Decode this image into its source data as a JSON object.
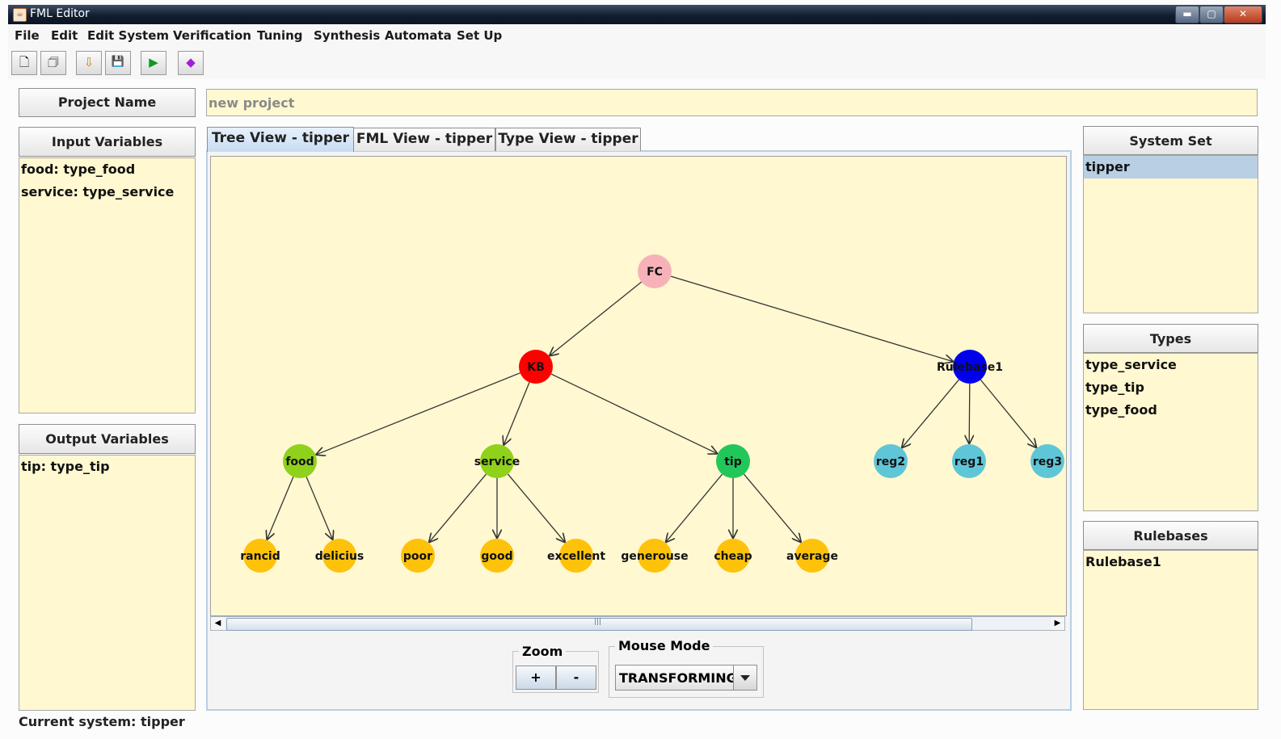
{
  "window": {
    "title": "FML Editor",
    "minimize": "▬",
    "maximize": "▢",
    "close": "✕"
  },
  "menu": [
    "File",
    "Edit",
    "Edit System",
    "Verification",
    "Tuning",
    "Synthesis",
    "Automata",
    "Set Up"
  ],
  "toolbar": {
    "icons": [
      "new-file-icon",
      "open-project-icon",
      "import-icon",
      "save-icon",
      "run-icon",
      "surface-plot-icon"
    ],
    "glyphs": [
      "🗋",
      "🗇",
      "⇩",
      "💾",
      "▶",
      "◆"
    ]
  },
  "project": {
    "label": "Project Name",
    "value": "new project"
  },
  "input_variables": {
    "label": "Input Variables",
    "items": [
      "food: type_food",
      "service: type_service"
    ]
  },
  "output_variables": {
    "label": "Output Variables",
    "items": [
      "tip: type_tip"
    ]
  },
  "status": "Current system: tipper",
  "tabs": [
    "Tree View - tipper",
    "FML View - tipper",
    "Type View - tipper"
  ],
  "active_tab": 0,
  "system_set": {
    "label": "System Set",
    "items": [
      "tipper"
    ],
    "selected": 0
  },
  "types": {
    "label": "Types",
    "items": [
      "type_service",
      "type_tip",
      "type_food"
    ]
  },
  "rulebases": {
    "label": "Rulebases",
    "items": [
      "Rulebase1"
    ]
  },
  "zoom": {
    "label": "Zoom",
    "in": "+",
    "out": "-"
  },
  "mouse_mode": {
    "label": "Mouse Mode",
    "value": "TRANSFORMING"
  },
  "scrollbar": {
    "left_arrow": "◀",
    "right_arrow": "▶",
    "grip": "|||"
  },
  "colors": {
    "root": "#f7b2b9",
    "kb": "#ff0000",
    "rulebase": "#0000ee",
    "variable_light": "#8fd11b",
    "variable_green": "#22c75a",
    "rule": "#5fc6d8",
    "term": "#ffc20a",
    "panel_bg": "#fff8d0"
  },
  "tree": {
    "nodes": [
      {
        "id": "FC",
        "label": "FC",
        "color_key": "root"
      },
      {
        "id": "KB",
        "label": "KB",
        "color_key": "kb"
      },
      {
        "id": "Rulebase1",
        "label": "Rulebase1",
        "color_key": "rulebase"
      },
      {
        "id": "food",
        "label": "food",
        "color_key": "variable_light"
      },
      {
        "id": "service",
        "label": "service",
        "color_key": "variable_light"
      },
      {
        "id": "tip",
        "label": "tip",
        "color_key": "variable_green"
      },
      {
        "id": "reg2",
        "label": "reg2",
        "color_key": "rule"
      },
      {
        "id": "reg1",
        "label": "reg1",
        "color_key": "rule"
      },
      {
        "id": "reg3",
        "label": "reg3",
        "color_key": "rule"
      },
      {
        "id": "rancid",
        "label": "rancid",
        "color_key": "term"
      },
      {
        "id": "delicius",
        "label": "delicius",
        "color_key": "term"
      },
      {
        "id": "poor",
        "label": "poor",
        "color_key": "term"
      },
      {
        "id": "good",
        "label": "good",
        "color_key": "term"
      },
      {
        "id": "excellent",
        "label": "excellent",
        "color_key": "term"
      },
      {
        "id": "generouse",
        "label": "generouse",
        "color_key": "term"
      },
      {
        "id": "cheap",
        "label": "cheap",
        "color_key": "term"
      },
      {
        "id": "average",
        "label": "average",
        "color_key": "term"
      }
    ],
    "edges": [
      [
        "FC",
        "KB"
      ],
      [
        "FC",
        "Rulebase1"
      ],
      [
        "KB",
        "food"
      ],
      [
        "KB",
        "service"
      ],
      [
        "KB",
        "tip"
      ],
      [
        "Rulebase1",
        "reg2"
      ],
      [
        "Rulebase1",
        "reg1"
      ],
      [
        "Rulebase1",
        "reg3"
      ],
      [
        "food",
        "rancid"
      ],
      [
        "food",
        "delicius"
      ],
      [
        "service",
        "poor"
      ],
      [
        "service",
        "good"
      ],
      [
        "service",
        "excellent"
      ],
      [
        "tip",
        "generouse"
      ],
      [
        "tip",
        "cheap"
      ],
      [
        "tip",
        "average"
      ]
    ]
  }
}
